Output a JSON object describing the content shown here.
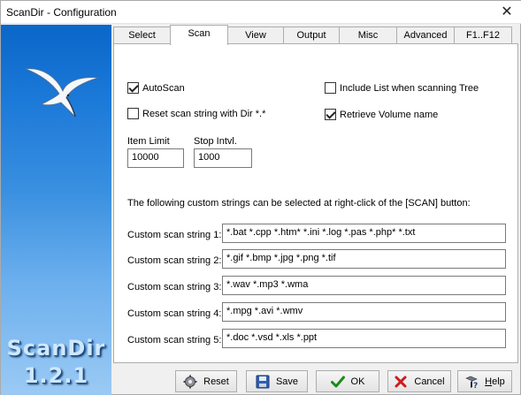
{
  "window": {
    "title": "ScanDir - Configuration",
    "close_glyph": "✕"
  },
  "banner": {
    "name": "ScanDir",
    "version": "1.2.1"
  },
  "tabs": [
    {
      "label": "Select"
    },
    {
      "label": "Scan",
      "active": true
    },
    {
      "label": "View"
    },
    {
      "label": "Output"
    },
    {
      "label": "Misc"
    },
    {
      "label": "Advanced"
    },
    {
      "label": "F1..F12"
    }
  ],
  "scan": {
    "autoscan": {
      "label": "AutoScan",
      "checked": true
    },
    "reset_scan": {
      "label": "Reset scan string with Dir *.*",
      "checked": false
    },
    "include_list": {
      "label": "Include List when scanning Tree",
      "checked": false
    },
    "retrieve_volume": {
      "label": "Retrieve Volume name",
      "checked": true
    },
    "item_limit": {
      "label": "Item Limit",
      "value": "10000"
    },
    "stop_intvl": {
      "label": "Stop Intvl.",
      "value": "1000"
    },
    "info_text": "The following custom strings can be selected at right-click of the [SCAN] button:",
    "custom": [
      {
        "label": "Custom scan string 1:",
        "value": "*.bat *.cpp *.htm* *.ini *.log *.pas *.php* *.txt"
      },
      {
        "label": "Custom scan string 2:",
        "value": "*.gif *.bmp *.jpg *.png *.tif"
      },
      {
        "label": "Custom scan string 3:",
        "value": "*.wav *.mp3 *.wma"
      },
      {
        "label": "Custom scan string 4:",
        "value": "*.mpg *.avi *.wmv"
      },
      {
        "label": "Custom scan string 5:",
        "value": "*.doc *.vsd *.xls *.ppt"
      }
    ]
  },
  "buttons": {
    "reset": {
      "label": "Reset",
      "icon": "gear-icon"
    },
    "save": {
      "label": "Save",
      "icon": "save-icon"
    },
    "ok": {
      "label": "OK",
      "icon": "checkmark-icon"
    },
    "cancel": {
      "label": "Cancel",
      "icon": "cross-icon"
    },
    "help_prefix": "H",
    "help_rest": "elp",
    "help_icon": "help-icon"
  },
  "colors": {
    "accent_blue": "#0a66c8",
    "ok_green": "#1a8a1a",
    "cancel_red": "#cc1b1b"
  }
}
